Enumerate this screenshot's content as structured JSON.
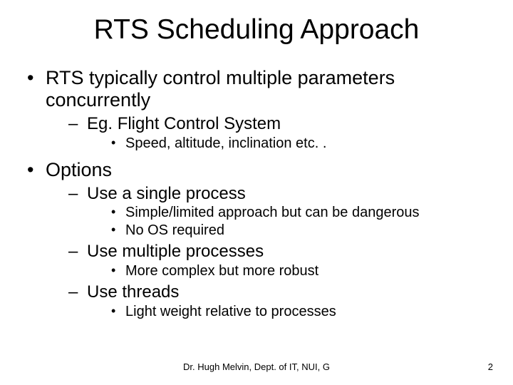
{
  "title": "RTS Scheduling Approach",
  "bullets": {
    "b1": "RTS typically control multiple parameters concurrently",
    "b1_1": "Eg. Flight Control System",
    "b1_1_1": "Speed, altitude, inclination etc. .",
    "b2": "Options",
    "b2_1": "Use a single process",
    "b2_1_1": "Simple/limited approach but can be dangerous",
    "b2_1_2": "No OS required",
    "b2_2": "Use multiple processes",
    "b2_2_1": "More complex but more robust",
    "b2_3": "Use threads",
    "b2_3_1": "Light weight relative to processes"
  },
  "footer": "Dr. Hugh Melvin, Dept. of IT, NUI, G",
  "page": "2"
}
